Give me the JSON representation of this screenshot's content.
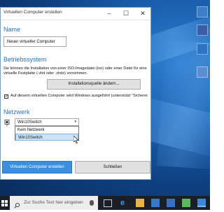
{
  "window": {
    "title": "Virtuellen Computer erstellen",
    "name_heading": "Name",
    "name_value": "Neuer virtueller Computer",
    "os_heading": "Betriebssystem",
    "os_description_line1": "Sie können die Installation von einer ISO-Imagedatei (iso) oder einer Datei für eine",
    "os_description_line2": "virtuelle Festplatte (.vhd oder .vhdx) vornehmen.",
    "change_source_button": "Installationsquelle ändern...",
    "checkbox_label": "Auf diesem virtuellen Computer wird Windows ausgeführt (unterstützt \"Sicherer S",
    "checkbox_checked": true,
    "network_heading": "Netzwerk",
    "network_selected": "Win10Switch",
    "network_options": [
      "Kein Netzwerk",
      "Win10Switch"
    ],
    "create_button": "Virtuellen Computer erstellen",
    "close_button": "Schließen"
  },
  "taskbar": {
    "search_placeholder": "Zur Suche Text hier eingeben"
  },
  "colors": {
    "accent": "#2a71b5",
    "primary_button": "#3c8fde",
    "taskbar": "#1a1e26"
  }
}
